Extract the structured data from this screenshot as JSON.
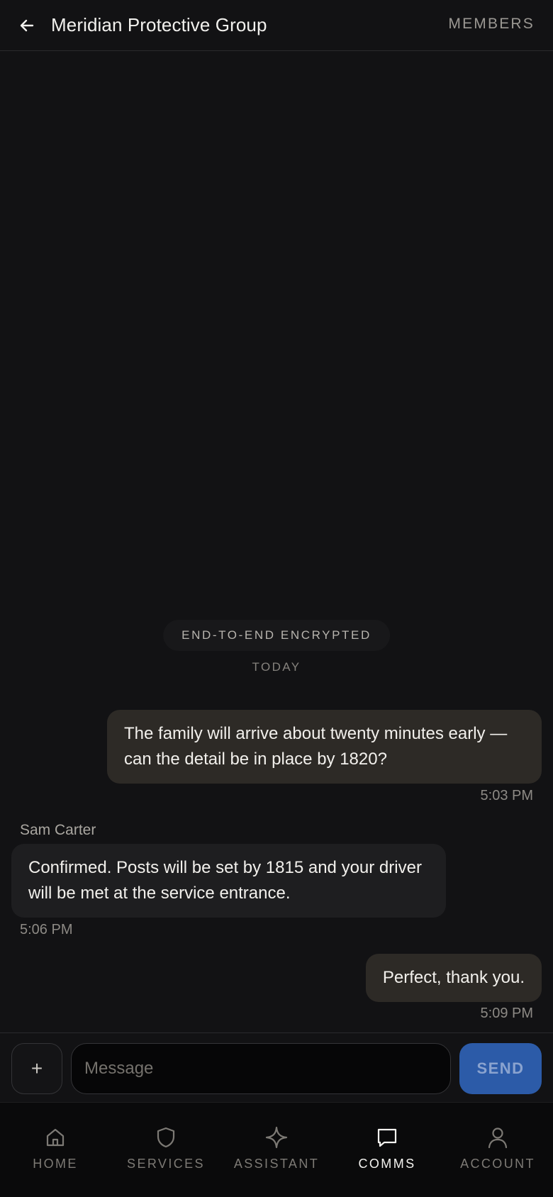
{
  "header": {
    "title": "Meridian Protective Group",
    "members_label": "MEMBERS"
  },
  "chat": {
    "encryption_notice": "END-TO-END ENCRYPTED",
    "day_label": "TODAY",
    "messages": [
      {
        "direction": "outgoing",
        "text": "The family will arrive about twenty minutes early — can the detail be in place by 1820?",
        "time": "5:03 PM"
      },
      {
        "direction": "incoming",
        "sender": "Sam Carter",
        "text": "Confirmed. Posts will be set by 1815 and your driver will be met at the service entrance.",
        "time": "5:06 PM"
      },
      {
        "direction": "outgoing",
        "text": "Perfect, thank you.",
        "time": "5:09 PM"
      }
    ]
  },
  "composer": {
    "attach_label": "+",
    "placeholder": "Message",
    "value": "",
    "send_label": "SEND"
  },
  "nav": {
    "items": [
      {
        "label": "HOME",
        "icon": "home-icon",
        "active": false
      },
      {
        "label": "SERVICES",
        "icon": "shield-icon",
        "active": false
      },
      {
        "label": "ASSISTANT",
        "icon": "sparkle-icon",
        "active": false
      },
      {
        "label": "COMMS",
        "icon": "chat-bubble-icon",
        "active": true
      },
      {
        "label": "ACCOUNT",
        "icon": "person-icon",
        "active": false
      }
    ]
  },
  "colors": {
    "background": "#121214",
    "outgoing_bubble": "#2d2a26",
    "incoming_bubble": "#1e1e20",
    "send_button": "#2c5ba8"
  }
}
